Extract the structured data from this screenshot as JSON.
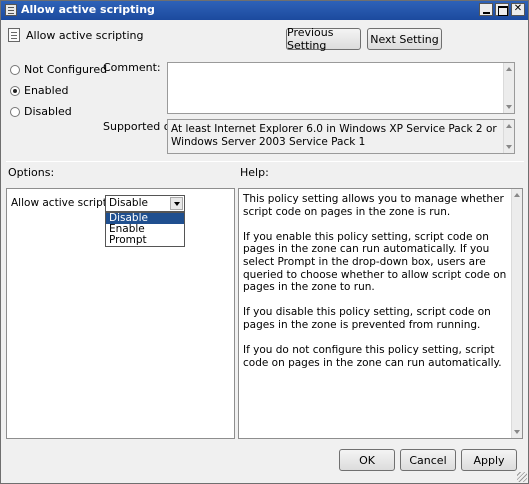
{
  "window": {
    "title": "Allow active scripting"
  },
  "header": {
    "setting_title": "Allow active scripting",
    "previous_label": "Previous Setting",
    "next_label": "Next Setting"
  },
  "state": {
    "not_configured_label": "Not Configured",
    "enabled_label": "Enabled",
    "disabled_label": "Disabled",
    "selected": "Enabled"
  },
  "comment": {
    "label": "Comment:",
    "value": ""
  },
  "supported": {
    "label": "Supported on:",
    "value": "At least Internet Explorer 6.0 in Windows XP Service Pack 2 or Windows Server 2003 Service Pack 1"
  },
  "options": {
    "label": "Options:",
    "field_label": "Allow active scripting",
    "selected_value": "Disable",
    "dropdown_items": [
      "Disable",
      "Enable",
      "Prompt"
    ]
  },
  "help": {
    "label": "Help:",
    "paragraphs": [
      "This policy setting allows you to manage whether script code on pages in the zone is run.",
      "If you enable this policy setting, script code on pages in the zone can run automatically. If you select Prompt in the drop-down box, users are queried to choose whether to allow script code on pages in the zone to run.",
      "If you disable this policy setting, script code on pages in the zone is prevented from running.",
      "If you do not configure this policy setting, script code on pages in the zone can run automatically."
    ]
  },
  "footer": {
    "ok_label": "OK",
    "cancel_label": "Cancel",
    "apply_label": "Apply"
  }
}
